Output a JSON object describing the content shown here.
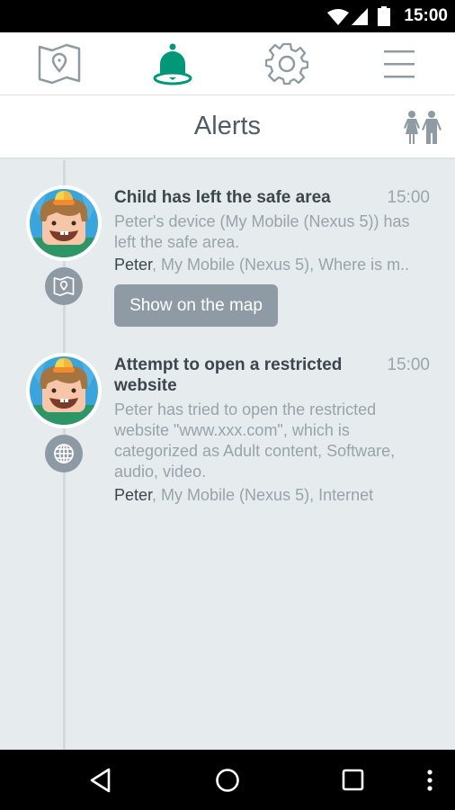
{
  "status_bar": {
    "time": "15:00",
    "icons": [
      "wifi-icon",
      "signal-icon",
      "battery-icon"
    ]
  },
  "top_nav": {
    "items": [
      {
        "id": "map",
        "icon": "map-pin-icon",
        "active": false
      },
      {
        "id": "alerts",
        "icon": "bell-icon",
        "active": true
      },
      {
        "id": "settings",
        "icon": "gear-icon",
        "active": false
      },
      {
        "id": "menu",
        "icon": "hamburger-menu-icon",
        "active": false
      }
    ],
    "active_color": "#009877",
    "inactive_color": "#8f9ba3"
  },
  "header": {
    "title": "Alerts",
    "right_icon": "family-icon"
  },
  "alerts": [
    {
      "type_icon": "map-pin-icon",
      "title": "Child has left the safe area",
      "time": "15:00",
      "body": "Peter's device (My Mobile (Nexus 5)) has left the safe area.",
      "child_name": "Peter",
      "meta_rest": ", My Mobile (Nexus 5), Where is m..",
      "action_label": "Show on the map"
    },
    {
      "type_icon": "globe-icon",
      "title": "Attempt to open a restricted website",
      "time": "15:00",
      "body": "Peter has tried to open the restricted website \"www.xxx.com\", which is categorized as Adult content, Software, audio, video.",
      "child_name": "Peter",
      "meta_rest": ", My Mobile (Nexus 5), Internet"
    }
  ],
  "system_nav": {
    "buttons": [
      "back-icon",
      "home-icon",
      "recents-icon",
      "overflow-menu-icon"
    ]
  }
}
